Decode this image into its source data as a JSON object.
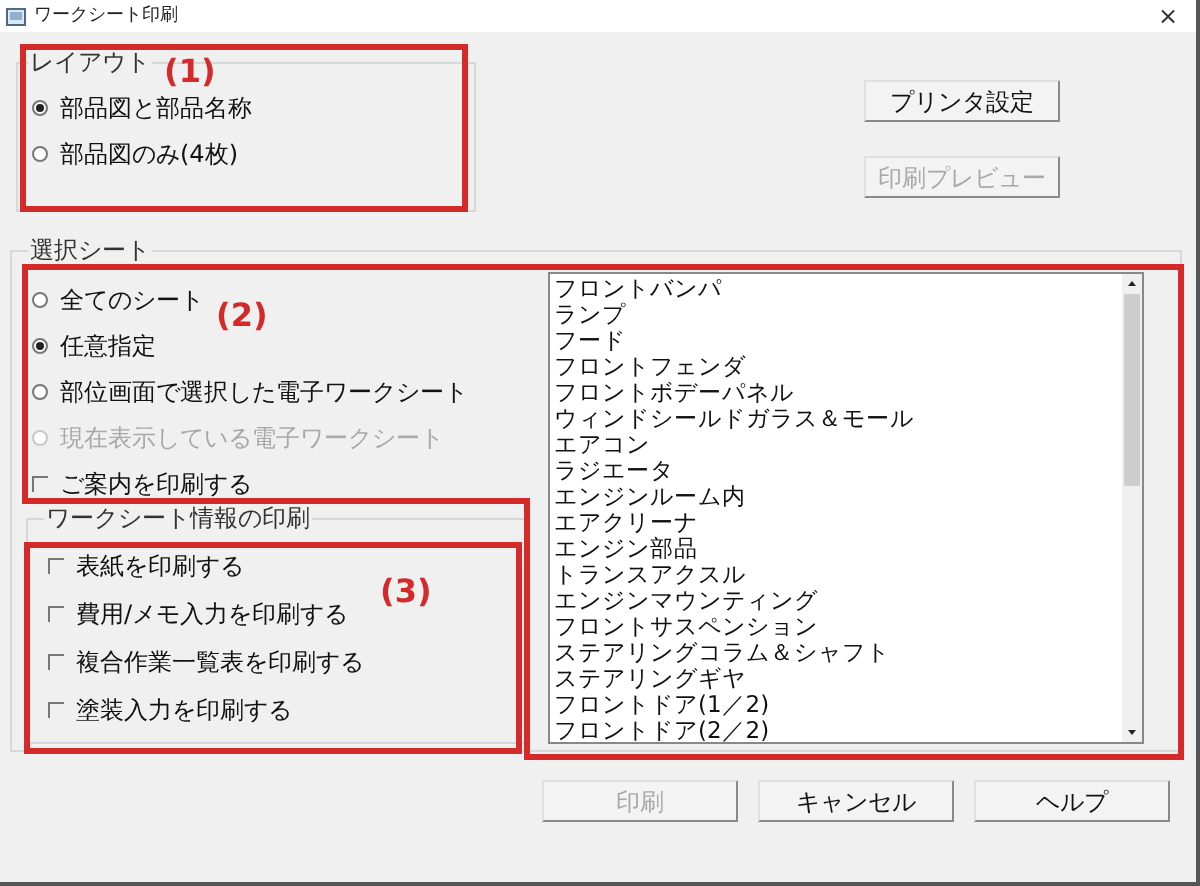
{
  "window": {
    "title": "ワークシート印刷",
    "close": "×"
  },
  "layout_group": {
    "title": "レイアウト",
    "options": [
      {
        "label": "部品図と部品名称",
        "selected": true
      },
      {
        "label": "部品図のみ(4枚)",
        "selected": false
      }
    ]
  },
  "side_buttons": [
    {
      "label": "プリンタ設定",
      "disabled": false
    },
    {
      "label": "印刷プレビュー",
      "disabled": true
    }
  ],
  "sheet_group": {
    "title": "選択シート",
    "options": [
      {
        "label": "全てのシート",
        "selected": false,
        "disabled": false
      },
      {
        "label": "任意指定",
        "selected": true,
        "disabled": false
      },
      {
        "label": "部位画面で選択した電子ワークシート",
        "selected": false,
        "disabled": false
      },
      {
        "label": "現在表示している電子ワークシート",
        "selected": false,
        "disabled": true
      }
    ],
    "guide_checkbox": {
      "label": "ご案内を印刷する",
      "checked": false
    },
    "sheet_list": [
      "フロントバンパ",
      "ランプ",
      "フード",
      "フロントフェンダ",
      "フロントボデーパネル",
      "ウィンドシールドガラス＆モール",
      "エアコン",
      "ラジエータ",
      "エンジンルーム内",
      "エアクリーナ",
      "エンジン部品",
      "トランスアクスル",
      "エンジンマウンティング",
      "フロントサスペンション",
      "ステアリングコラム＆シャフト",
      "ステアリングギヤ",
      "フロントドア(1／2)",
      "フロントドア(2／2)"
    ]
  },
  "info_group": {
    "title": "ワークシート情報の印刷",
    "options": [
      {
        "label": "表紙を印刷する",
        "checked": false
      },
      {
        "label": "費用/メモ入力を印刷する",
        "checked": false
      },
      {
        "label": "複合作業一覧表を印刷する",
        "checked": false
      },
      {
        "label": "塗装入力を印刷する",
        "checked": false
      }
    ]
  },
  "buttons": [
    {
      "label": "印刷",
      "disabled": true
    },
    {
      "label": "キャンセル",
      "disabled": false
    },
    {
      "label": "ヘルプ",
      "disabled": false
    }
  ],
  "annotations": [
    "(1)",
    "(2)",
    "(3)"
  ]
}
